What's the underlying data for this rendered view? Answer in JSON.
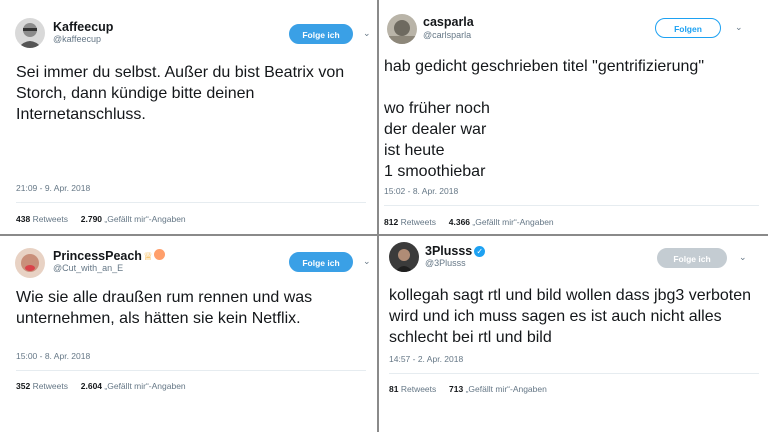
{
  "tweets": [
    {
      "name": "Kaffeecup",
      "handle": "@kaffeecup",
      "button": "Folge ich",
      "text": "Sei immer du selbst. Außer du bist Beatrix von Storch, dann kündige bitte deinen Internetanschluss.",
      "time": "21:09 - 9. Apr. 2018",
      "retweets": "438",
      "retweets_label": "Retweets",
      "likes": "2.790",
      "likes_label": "„Gefällt mir“-Angaben"
    },
    {
      "name": "casparla",
      "handle": "@carlsparla",
      "button": "Folgen",
      "text": "hab gedicht geschrieben titel \"gentrifizierung\"\n\nwo früher noch\nder dealer war\nist heute\n1 smoothiebar",
      "time": "15:02 - 8. Apr. 2018",
      "retweets": "812",
      "retweets_label": "Retweets",
      "likes": "4.366",
      "likes_label": "„Gefällt mir“-Angaben"
    },
    {
      "name": "PrincessPeach",
      "handle": "@Cut_with_an_E",
      "button": "Folge ich",
      "text": "Wie sie alle draußen rum rennen und was unternehmen, als hätten sie kein Netflix.",
      "time": "15:00 - 8. Apr. 2018",
      "retweets": "352",
      "retweets_label": "Retweets",
      "likes": "2.604",
      "likes_label": "„Gefällt mir“-Angaben"
    },
    {
      "name": "3Plusss",
      "handle": "@3Plusss",
      "button": "Folge ich",
      "text": "kollegah sagt rtl und bild wollen dass jbg3 verboten wird und ich muss sagen es ist auch nicht alles schlecht bei rtl und bild",
      "time": "14:57 - 2. Apr. 2018",
      "retweets": "81",
      "retweets_label": "Retweets",
      "likes": "713",
      "likes_label": "„Gefällt mir“-Angaben"
    }
  ],
  "icons": {
    "menu": "chevron-down-icon",
    "verified": "verified-badge-icon",
    "crown": "crown-icon",
    "peach": "peach-icon"
  },
  "colors": {
    "twitter_blue": "#1da1f2",
    "follow_blue": "#3aa0e6",
    "grey_button": "#c4ccd2",
    "meta_text": "#657786",
    "divider": "#8a8a8a"
  }
}
